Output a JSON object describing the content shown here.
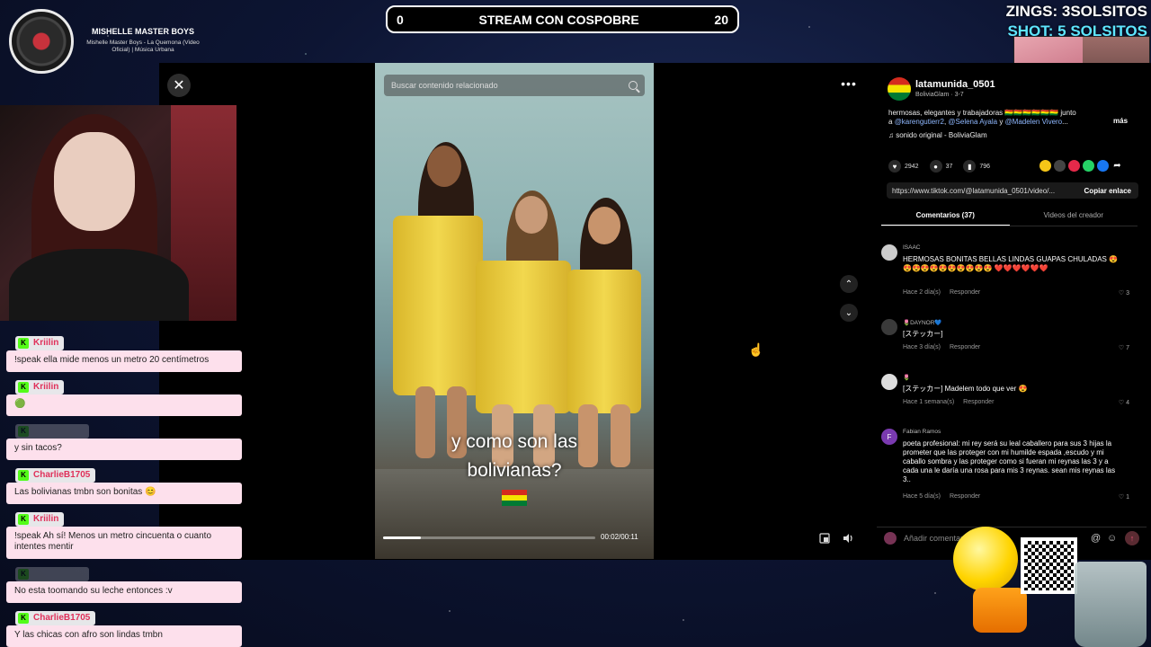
{
  "music": {
    "title": "MISHELLE MASTER BOYS",
    "subtitle": "Mishelle Master Boys - La Quemona (Video Oficial) | Música Urbana"
  },
  "scoreboard": {
    "left_score": "0",
    "title": "STREAM CON COSPOBRE",
    "right_score": "20"
  },
  "overlay": {
    "zings": "ZINGS: 3SOLSITOS",
    "shot": "SHOT: 5 SOLSITOS"
  },
  "viewer": {
    "close": "✕",
    "search_placeholder": "Buscar contenido relacionado",
    "caption_line1": "y como son las",
    "caption_line2": "bolivianas?",
    "time": "00:02/00:11",
    "progress": 0.18,
    "more": "•••",
    "nav_up": "⌃",
    "nav_down": "⌄"
  },
  "post": {
    "author": "latamunida_0501",
    "author_meta": "BoliviaGlam · 3-7",
    "desc_text": "hermosas, elegantes y trabajadoras 🇧🇴🇧🇴🇧🇴🇧🇴🇧🇴🇧🇴 junto a",
    "mention1": "@karengutierr2",
    "mention2": "@Selena Ayala",
    "and": "y",
    "mention3": "@Madelen Vivero",
    "more": "más",
    "sound": "♫  sonido original - BoliviaGlam",
    "likes": "2942",
    "comments": "37",
    "saves": "796",
    "url": "https://www.tiktok.com/@latamunida_0501/video/...",
    "copy_label": "Copiar enlace"
  },
  "tabs": {
    "comments": "Comentarios (37)",
    "creator_videos": "Videos del creador"
  },
  "comments": [
    {
      "user": "ISAAC",
      "text": "HERMOSAS BONITAS BELLAS LINDAS GUAPAS CHULADAS 😍😍😍😍😍😍😍😍😍😍😍 ❤️❤️❤️❤️❤️❤️",
      "time": "Hace 2 día(s)",
      "reply": "Responder",
      "likes": "♡ 3"
    },
    {
      "user": "🌷DAYNOR💙",
      "text": "[ステッカー]",
      "time": "Hace 3 día(s)",
      "reply": "Responder",
      "likes": "♡ 7"
    },
    {
      "user": "🌷",
      "text": "[ステッカー] Madelem todo que ver 😍",
      "time": "Hace 1 semana(s)",
      "reply": "Responder",
      "likes": "♡ 4"
    },
    {
      "user": "Fabian Ramos",
      "avatar": "F",
      "text": "poeta profesional: mi rey será su leal caballero para sus 3 hijas la prometer que las proteger con mi humilde espada ,escudo y mi caballo sombra y las proteger como si fueran mi reynas las 3 y a cada una le daría una rosa para mis 3 reynas. sean mis reynas las 3..",
      "time": "Hace 5 día(s)",
      "reply": "Responder",
      "likes": "♡ 1"
    }
  ],
  "add_comment": {
    "placeholder": "Añadir comentario...",
    "at": "@",
    "emoji": "☺",
    "send": "↑"
  },
  "chat": [
    {
      "name": "Kriilin",
      "text": "!speak ella mide menos un metro 20 centímetros"
    },
    {
      "name": "Kriilin",
      "text": "🟢"
    },
    {
      "name": "",
      "text": "y sin tacos?"
    },
    {
      "name": "CharlieB1705",
      "text": "Las bolivianas tmbn son bonitas 😊"
    },
    {
      "name": "Kriilin",
      "text": "!speak Ah sí! Menos un metro cincuenta o cuanto intentes mentir"
    },
    {
      "name": "",
      "text": "No esta toomando su leche entonces :v"
    },
    {
      "name": "CharlieB1705",
      "text": "Y las chicas con afro son lindas tmbn"
    }
  ],
  "colors": {
    "accent_pink": "#e0305a",
    "kick_green": "#53fc18",
    "chat_bubble": "#fde0ec",
    "score_cyan": "#5ee6ff"
  }
}
